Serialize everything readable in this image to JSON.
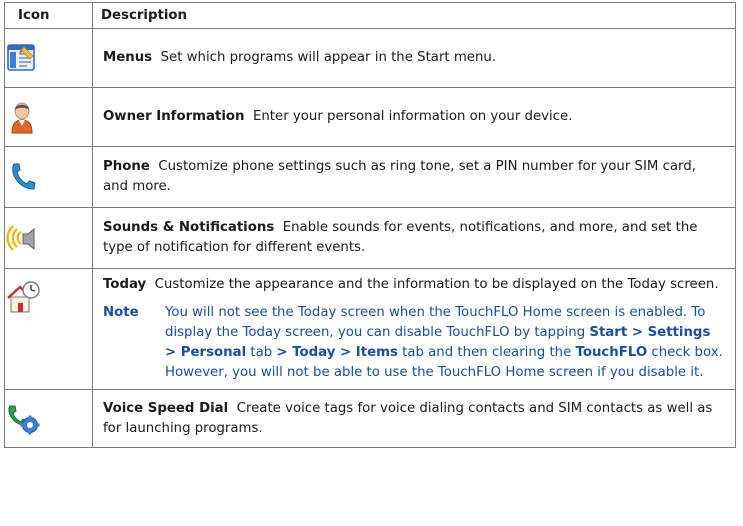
{
  "header": {
    "icon_col": "Icon",
    "desc_col": "Description"
  },
  "rows": [
    {
      "icon": "menus-icon",
      "term": "Menus",
      "text": "Set which programs will appear in the Start menu."
    },
    {
      "icon": "owner-information-icon",
      "term": "Owner Information",
      "text": "Enter your personal information on your device."
    },
    {
      "icon": "phone-icon",
      "term": "Phone",
      "text": "Customize phone settings such as ring tone, set a PIN number for your SIM card, and more."
    },
    {
      "icon": "sounds-notifications-icon",
      "term": "Sounds & Notifications",
      "text": "Enable sounds for events, notifications, and more, and set the type of notification for different events."
    },
    {
      "icon": "today-icon",
      "term": "Today",
      "text": "Customize the appearance and the information to be displayed on the Today screen.",
      "note": {
        "label": "Note",
        "p1": "You will not see the Today screen when the TouchFLO Home screen is enabled. To display the Today screen, you can disable TouchFLO by tapping",
        "b1": "Start > Settings > Personal",
        "p2": "tab",
        "b2": "> Today > Items",
        "p3": "tab and then clearing the",
        "b3": "TouchFLO",
        "p4": "check box. However, you will not be able to use the TouchFLO Home screen if you disable it."
      }
    },
    {
      "icon": "voice-speed-dial-icon",
      "term": "Voice Speed Dial",
      "text": "Create voice tags for voice dialing contacts and SIM contacts as well as for launching programs."
    }
  ],
  "colors": {
    "note_blue": "#1a4ea1",
    "border": "#7a7a7a"
  }
}
